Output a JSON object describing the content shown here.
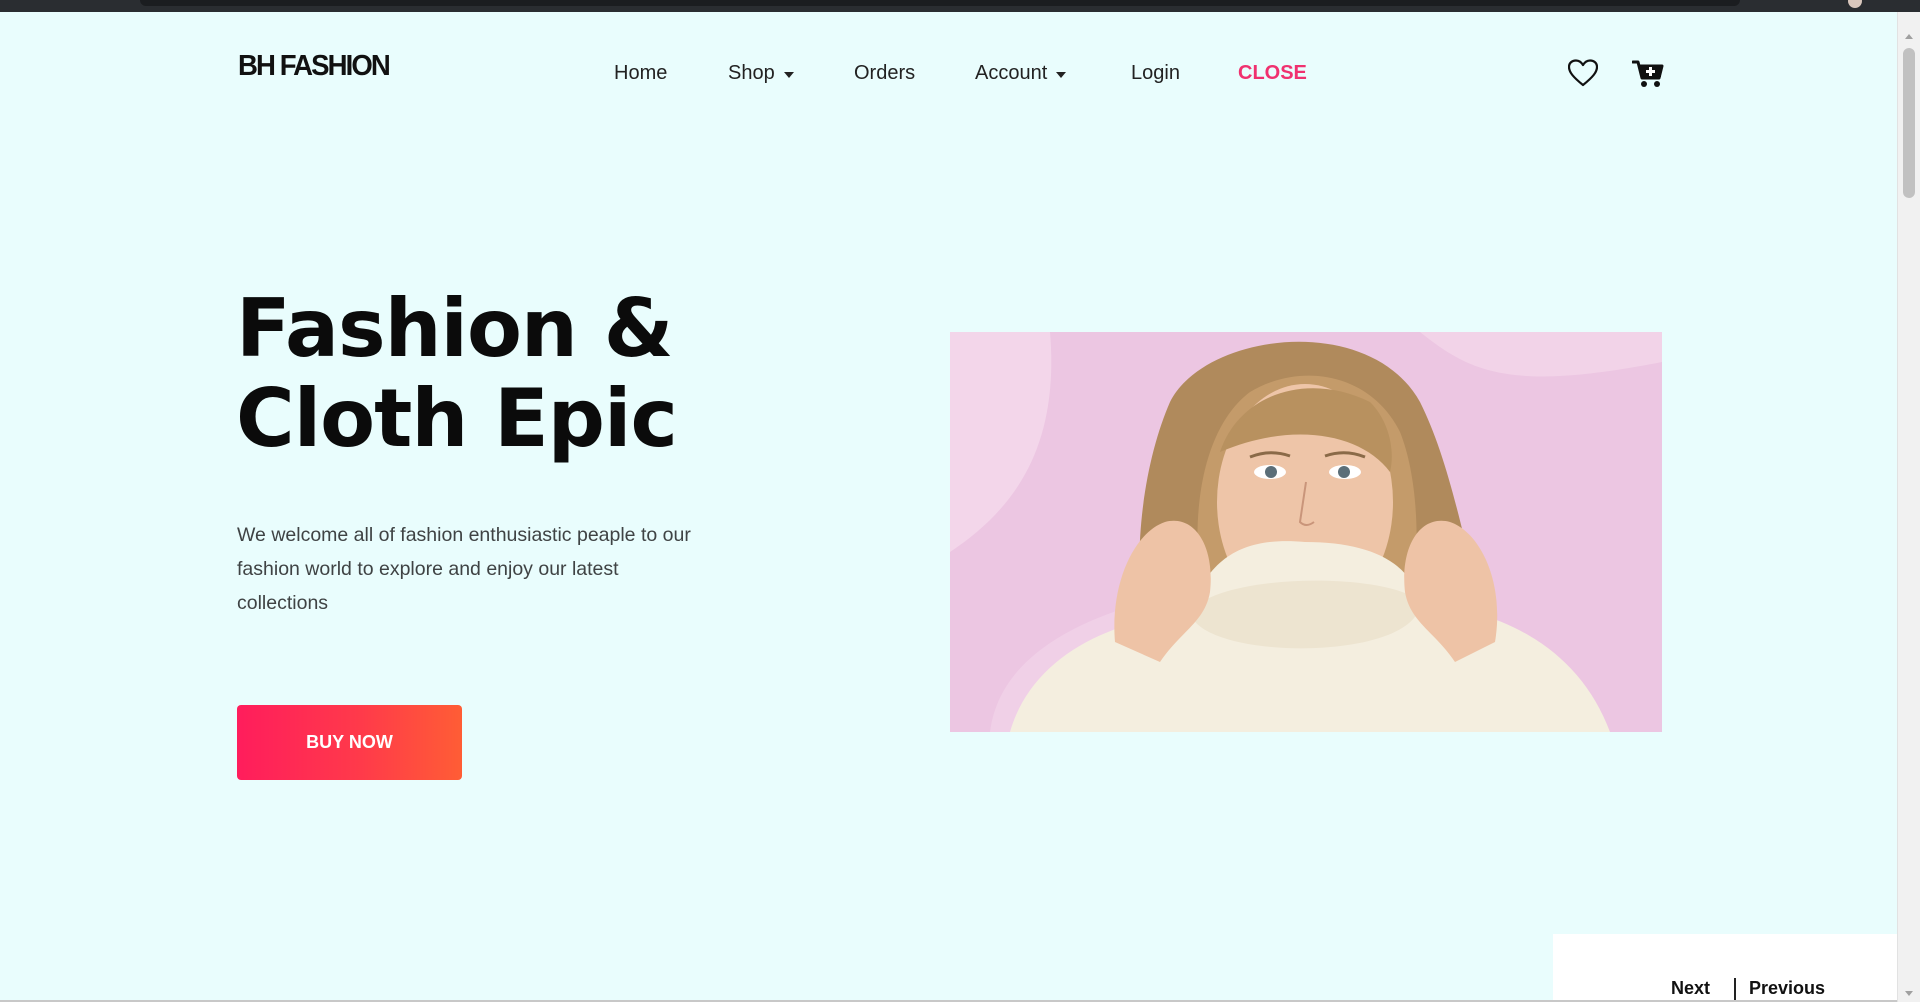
{
  "brand": {
    "logo_text": "BH FASHION"
  },
  "nav": {
    "items": [
      {
        "label": "Home"
      },
      {
        "label": "Shop"
      },
      {
        "label": "Orders"
      },
      {
        "label": "Account"
      },
      {
        "label": "Login"
      },
      {
        "label": "CLOSE"
      }
    ],
    "icons": [
      "heart-icon",
      "cart-icon"
    ]
  },
  "hero": {
    "title_line1": "Fashion &",
    "title_line2": "Cloth Epic",
    "description": "We welcome all of fashion enthusiastic peaple to our fashion world to explore and enjoy our latest collections",
    "cta_label": "BUY NOW",
    "image_desc_icon": "model-photo"
  },
  "pager": {
    "next_label": "Next",
    "previous_label": "Previous"
  },
  "colors": {
    "page_bg": "#e9fdfd",
    "accent": "#f0316f",
    "button_gradient_start": "#ff1d5c",
    "button_gradient_end": "#ff5d35",
    "image_bg": "#ecc6e2"
  }
}
